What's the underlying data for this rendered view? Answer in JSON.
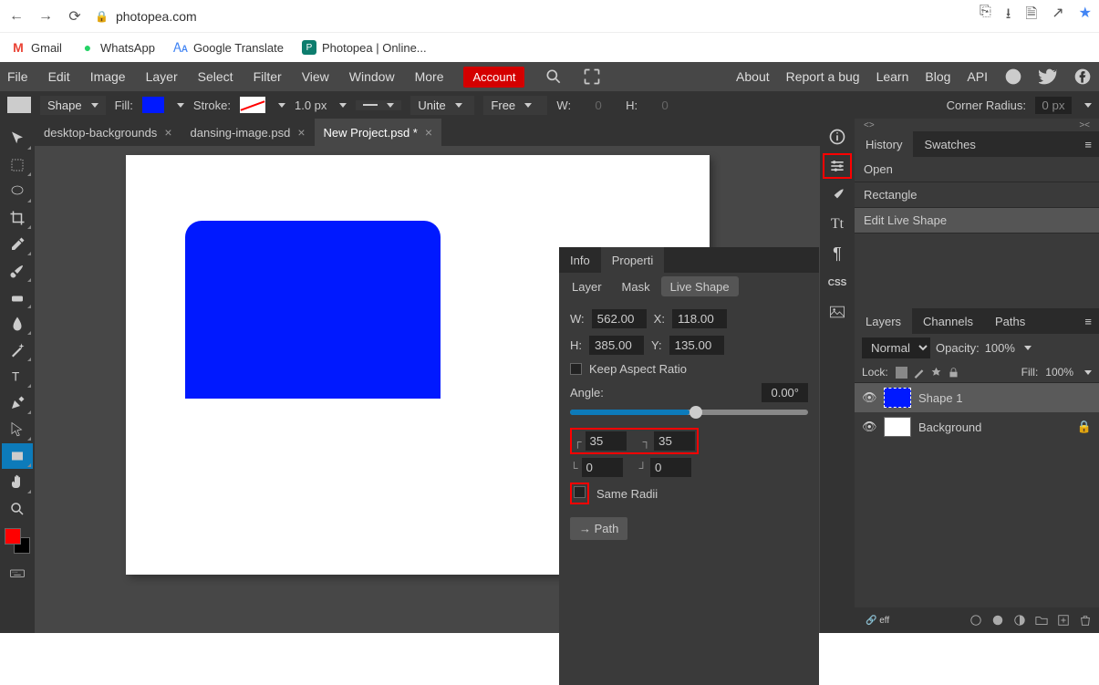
{
  "browser": {
    "url": "photopea.com",
    "bookmarks": [
      "Gmail",
      "WhatsApp",
      "Google Translate",
      "Photopea | Online..."
    ]
  },
  "menu": {
    "items": [
      "File",
      "Edit",
      "Image",
      "Layer",
      "Select",
      "Filter",
      "View",
      "Window",
      "More"
    ],
    "account": "Account",
    "right": [
      "About",
      "Report a bug",
      "Learn",
      "Blog",
      "API"
    ]
  },
  "options": {
    "mode": "Shape",
    "fill_label": "Fill:",
    "stroke_label": "Stroke:",
    "stroke_width": "1.0 px",
    "combine": "Unite",
    "align": "Free",
    "w_label": "W:",
    "w_val": "0",
    "h_label": "H:",
    "h_val": "0",
    "corner_label": "Corner Radius:",
    "corner_val": "0 px"
  },
  "tabs": [
    {
      "name": "desktop-backgrounds",
      "active": false
    },
    {
      "name": "dansing-image.psd",
      "active": false
    },
    {
      "name": "New Project.psd *",
      "active": true
    }
  ],
  "properties": {
    "main_tabs": [
      "Info",
      "Properti"
    ],
    "sub_tabs": [
      "Layer",
      "Mask",
      "Live Shape"
    ],
    "w_label": "W:",
    "w_val": "562.00",
    "x_label": "X:",
    "x_val": "118.00",
    "h_label": "H:",
    "h_val": "385.00",
    "y_label": "Y:",
    "y_val": "135.00",
    "keep_ratio": "Keep Aspect Ratio",
    "angle_label": "Angle:",
    "angle_val": "0.00°",
    "radii": {
      "tl": "35",
      "tr": "35",
      "bl": "0",
      "br": "0"
    },
    "same_radii": "Same Radii",
    "path_btn": "→ Path"
  },
  "side_icons": [
    "<>",
    "ℹ",
    "≡",
    "brush",
    "Tt",
    "¶",
    "CSS",
    "img"
  ],
  "history": {
    "tabs": [
      "History",
      "Swatches"
    ],
    "items": [
      "Open",
      "Rectangle",
      "Edit Live Shape"
    ]
  },
  "layers": {
    "tabs": [
      "Layers",
      "Channels",
      "Paths"
    ],
    "blend": "Normal",
    "opacity_label": "Opacity:",
    "opacity": "100%",
    "lock_label": "Lock:",
    "fill_label": "Fill:",
    "fill": "100%",
    "items": [
      {
        "name": "Shape 1",
        "selected": true
      },
      {
        "name": "Background",
        "selected": false,
        "locked": true
      }
    ],
    "footer_text": "eff"
  }
}
